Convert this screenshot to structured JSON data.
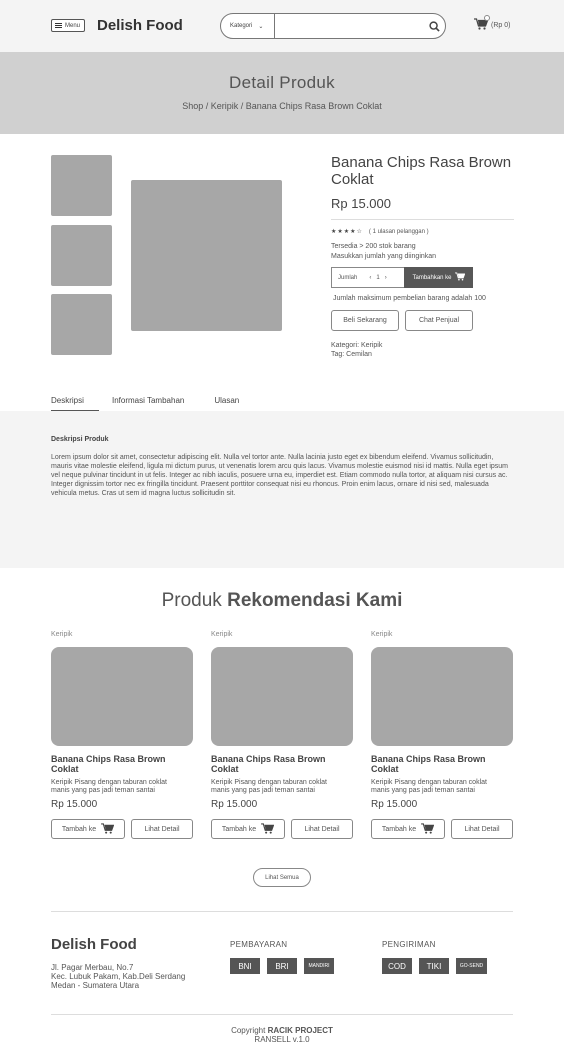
{
  "header": {
    "menu_label": "Menu",
    "brand": "Delish Food",
    "category_label": "Kategori",
    "search_placeholder": "",
    "cart_total": "(Rp 0)"
  },
  "banner": {
    "title": "Detail Produk",
    "breadcrumb": "Shop / Keripik / Banana Chips Rasa Brown Coklat"
  },
  "product": {
    "title": "Banana Chips Rasa Brown Coklat",
    "price": "Rp 15.000",
    "rating_stars": 4,
    "reviews": "( 1 ulasan pelanggan )",
    "stock": "Tersedia > 200 stok barang",
    "qty_hint": "Masukkan jumlah yang diinginkan",
    "qty_label": "Jumlah",
    "qty_value": "1",
    "add_to_cart": "Tambahkan ke",
    "max_note": "Jumlah maksimum pembelian barang adalah 100",
    "buy_now": "Beli Sekarang",
    "chat_seller": "Chat Penjual",
    "category": "Kategori: Keripik",
    "tag": "Tag: Cemilan"
  },
  "tabs": [
    "Deskripsi",
    "Informasi Tambahan",
    "Ulasan"
  ],
  "description": {
    "heading": "Deskripsi Produk",
    "text": "Lorem ipsum dolor sit amet, consectetur adipiscing elit. Nulla vel tortor ante. Nulla lacinia justo eget ex bibendum eleifend. Vivamus sollicitudin, mauris vitae molestie eleifend, ligula mi dictum purus, ut venenatis lorem arcu quis lacus. Vivamus molestie euismod nisi id mattis. Nulla eget ipsum vel neque pulvinar tincidunt in ut felis. Integer ac nibh iaculis, posuere urna eu, imperdiet est. Etiam commodo nulla tortor, at aliquam nisi cursus ac. Integer dignissim tortor nec ex fringilla tincidunt. Praesent porttitor consequat nisi eu rhoncus. Proin enim lacus, ornare id nisi sed, malesuada vehicula metus. Cras ut sem id magna luctus sollicitudin sit."
  },
  "recommend": {
    "title_light": "Produk",
    "title_bold": "Rekomendasi Kami",
    "cards": [
      {
        "category": "Keripik",
        "name": "Banana Chips Rasa Brown Coklat",
        "desc": "Keripik Pisang dengan taburan coklat manis yang pas jadi teman santai",
        "price": "Rp 15.000",
        "add_label": "Tambah ke",
        "detail_label": "Lihat Detail"
      },
      {
        "category": "Keripik",
        "name": "Banana Chips Rasa Brown Coklat",
        "desc": "Keripik Pisang dengan taburan coklat manis yang pas jadi teman santai",
        "price": "Rp 15.000",
        "add_label": "Tambah ke",
        "detail_label": "Lihat Detail"
      },
      {
        "category": "Keripik",
        "name": "Banana Chips Rasa Brown Coklat",
        "desc": "Keripik Pisang dengan taburan coklat manis yang pas jadi teman santai",
        "price": "Rp 15.000",
        "add_label": "Tambah ke",
        "detail_label": "Lihat Detail"
      }
    ],
    "see_all": "Lihat Semua"
  },
  "footer": {
    "brand": "Delish Food",
    "address": [
      "Jl. Pagar Merbau, No.7",
      "Kec. Lubuk Pakam, Kab.Deli Serdang",
      "Medan - Sumatera Utara"
    ],
    "payment_heading": "PEMBAYARAN",
    "payments": [
      "BNI",
      "BRI",
      "MANDIRI"
    ],
    "shipping_heading": "PENGIRIMAN",
    "shipping": [
      "COD",
      "TIKI",
      "GO-SEND"
    ],
    "copyright_prefix": "Copyright",
    "copyright_owner": "RACIK PROJECT",
    "version": "RANSELL v.1.0"
  },
  "colors": {
    "page_bg": "#ffffff",
    "header_bg": "#f4f4f4",
    "banner_bg": "#d0d0d0",
    "placeholder": "#a7a7a7",
    "button_dark": "#575757"
  }
}
